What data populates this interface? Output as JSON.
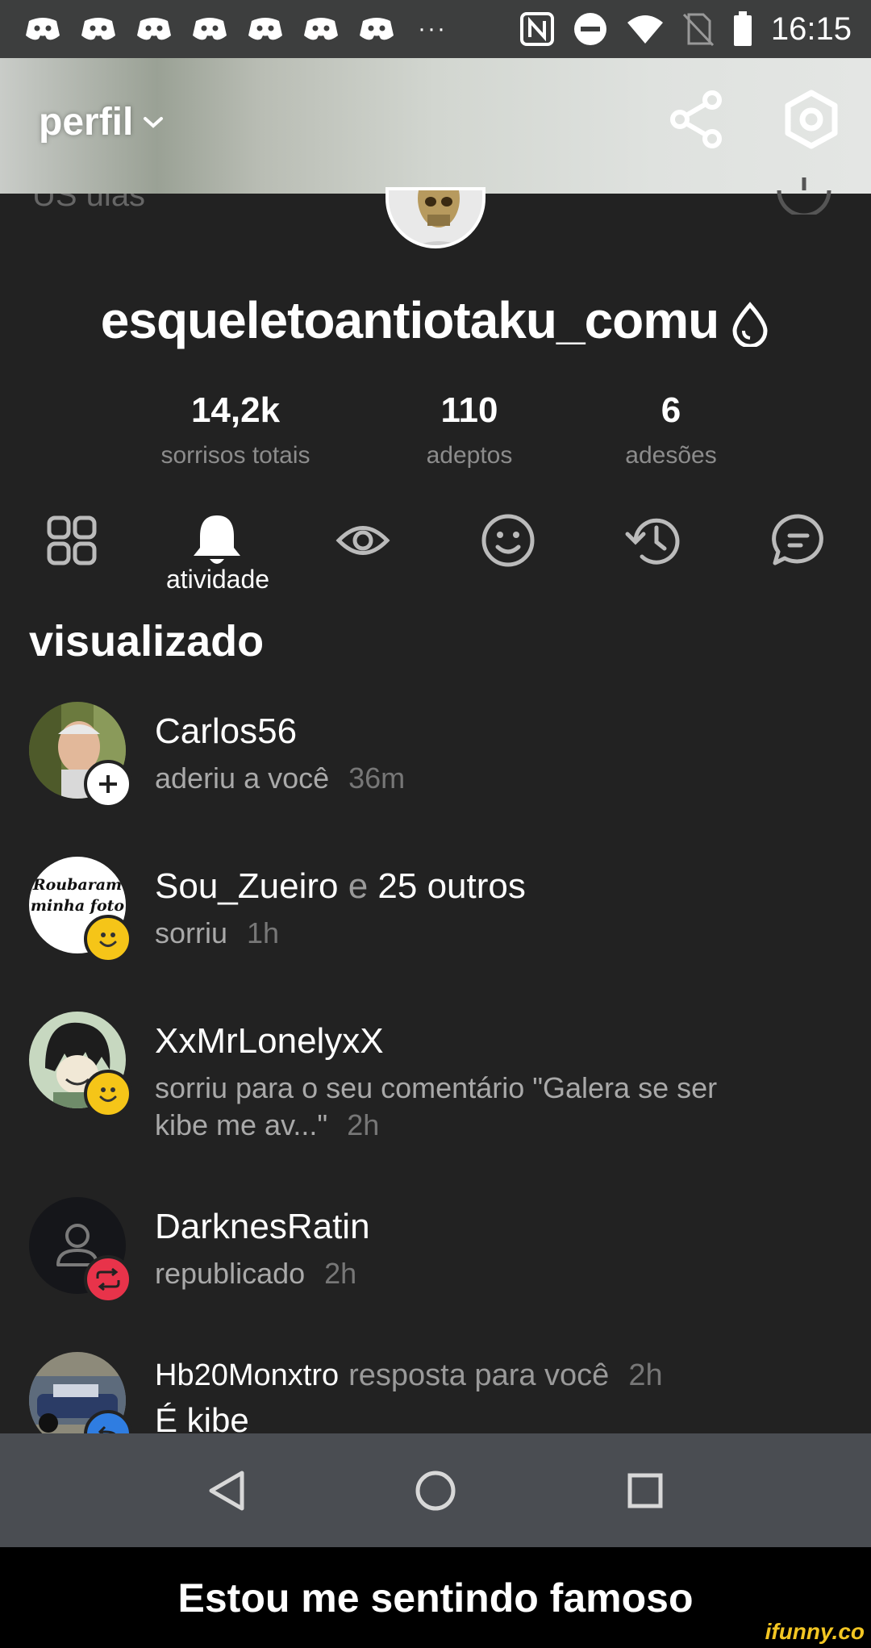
{
  "status_bar": {
    "time": "16:15",
    "overflow": "···",
    "notification_icons": [
      "discord-icon",
      "discord-icon",
      "discord-icon",
      "discord-icon",
      "discord-icon",
      "discord-icon",
      "discord-icon"
    ]
  },
  "header": {
    "title": "perfil",
    "share_icon": "share-icon",
    "settings_icon": "settings-hexagon-icon"
  },
  "profile": {
    "peek_text": "US ulas",
    "username": "esqueletoantiotaku_comu",
    "stats": [
      {
        "value": "14,2k",
        "label": "sorrisos totais"
      },
      {
        "value": "110",
        "label": "adeptos"
      },
      {
        "value": "6",
        "label": "adesões"
      }
    ]
  },
  "tabs": {
    "active_label": "atividade",
    "icons": [
      "grid-icon",
      "bell-icon",
      "eye-icon",
      "smile-icon",
      "history-icon",
      "comment-icon"
    ]
  },
  "section_title": "visualizado",
  "feed": [
    {
      "name": "Carlos56",
      "name_suffix": "",
      "action": "aderiu a você",
      "time": "36m",
      "badge": "plus-icon"
    },
    {
      "name": "Sou_Zueiro",
      "name_suffix": " e ",
      "others": "25 outros",
      "action": "sorriu",
      "time": "1h",
      "badge": "smile-icon",
      "avatar_text": "Roubaram minha foto"
    },
    {
      "name": "XxMrLonelyxX",
      "action": "sorriu para o seu comentário \"Galera se ser kibe me av...\"",
      "time": "2h",
      "badge": "smile-icon"
    },
    {
      "name": "DarknesRatin",
      "action": "republicado",
      "time": "2h",
      "badge": "repost-icon"
    },
    {
      "name": "Hb20Monxtro",
      "inline_action": "resposta para você",
      "time": "2h",
      "action": "É kibe",
      "badge": "reply-icon"
    }
  ],
  "colors": {
    "background": "#222222",
    "badge_yellow": "#f5c518",
    "badge_red": "#e8334a",
    "badge_blue": "#2f7de1",
    "navbar": "#4a4d52"
  },
  "caption": "Estou me sentindo famoso",
  "watermark": "ifunny.co"
}
